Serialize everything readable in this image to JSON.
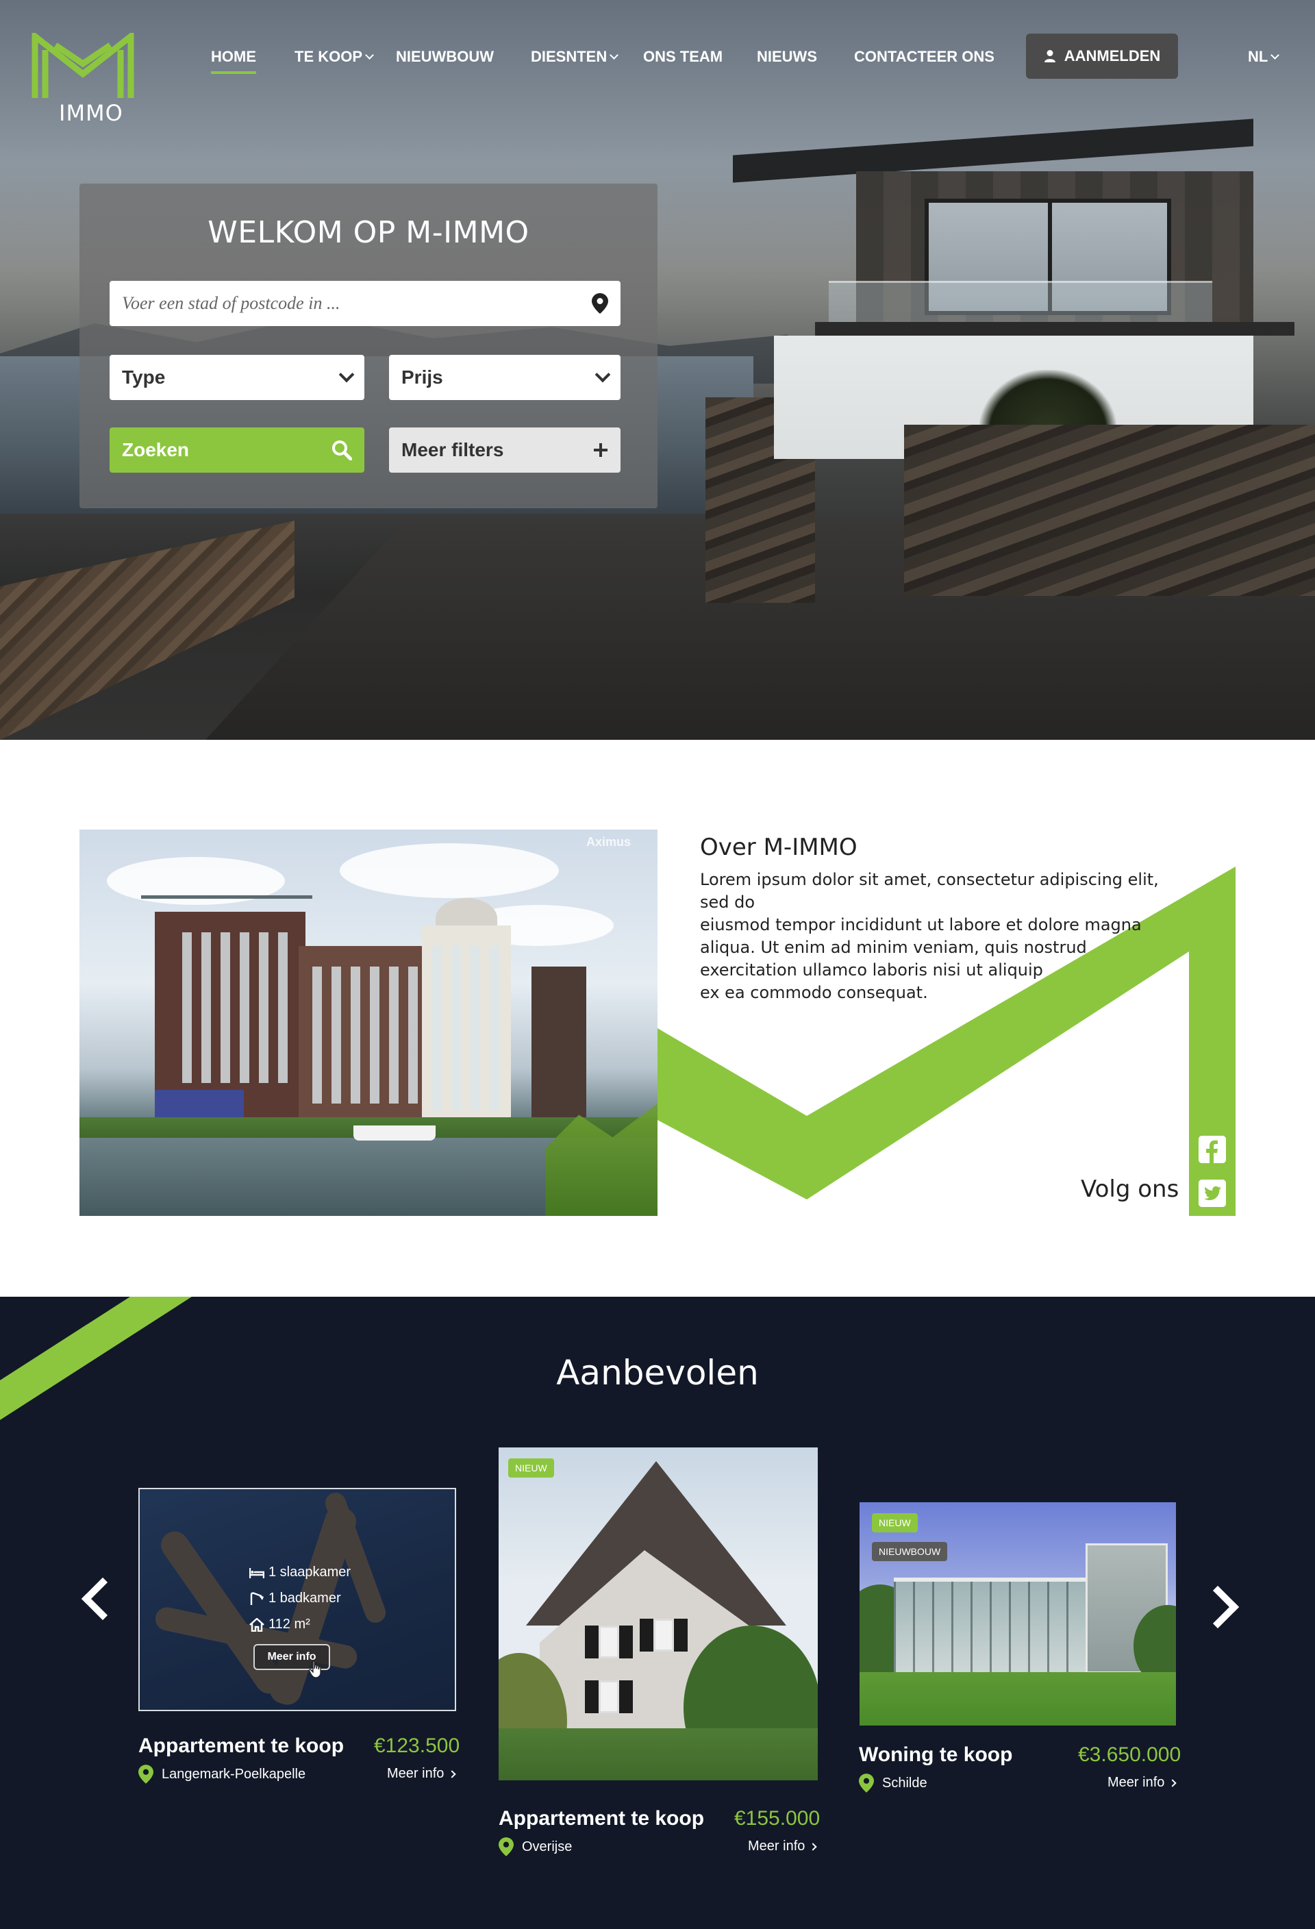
{
  "brand": {
    "logo_text": "IMMO",
    "accent_color": "#8cc63f",
    "dark_color": "#121827"
  },
  "nav": {
    "items": [
      {
        "label": "HOME",
        "active": true,
        "dropdown": false
      },
      {
        "label": "TE KOOP",
        "active": false,
        "dropdown": true
      },
      {
        "label": "NIEUWBOUW",
        "active": false,
        "dropdown": false
      },
      {
        "label": "DIESNTEN",
        "active": false,
        "dropdown": true
      },
      {
        "label": "ONS TEAM",
        "active": false,
        "dropdown": false
      },
      {
        "label": "NIEUWS",
        "active": false,
        "dropdown": false
      },
      {
        "label": "CONTACTEER ONS",
        "active": false,
        "dropdown": false
      }
    ],
    "login_label": "AANMELDEN",
    "login_icon": "user-icon",
    "language": "NL"
  },
  "search": {
    "title": "WELKOM OP M-IMMO",
    "location_placeholder": "Voer een stad of postcode in ...",
    "location_icon": "map-pin-icon",
    "type_label": "Type",
    "price_label": "Prijs",
    "search_label": "Zoeken",
    "search_icon": "search-icon",
    "more_filters_label": "Meer filters",
    "more_filters_icon": "plus-icon"
  },
  "about": {
    "title": "Over M-IMMO",
    "lines": [
      "Lorem ipsum dolor sit amet, consectetur adipiscing elit, sed do",
      "eiusmod tempor incididunt ut labore et dolore magna",
      "aliqua. Ut enim ad minim veniam, quis nostrud",
      "exercitation ullamco laboris nisi ut aliquip",
      "ex ea commodo consequat."
    ],
    "follow_label": "Volg ons",
    "social": [
      "facebook-icon",
      "twitter-icon"
    ]
  },
  "featured": {
    "title": "Aanbevolen",
    "cards": [
      {
        "title": "Appartement te koop",
        "price": "€123.500",
        "location": "Langemark-Poelkapelle",
        "more": "Meer info",
        "badges": [],
        "features": [
          "1 slaapkamer",
          "1 badkamer",
          "112 m²"
        ],
        "overlay_button": "Meer info"
      },
      {
        "title": "Appartement te koop",
        "price": "€155.000",
        "location": "Overijse",
        "more": "Meer info",
        "badges": [
          "NIEUW"
        ]
      },
      {
        "title": "Woning te koop",
        "price": "€3.650.000",
        "location": "Schilde",
        "more": "Meer info",
        "badges": [
          "NIEUW",
          "NIEUWBOUW"
        ]
      }
    ]
  }
}
